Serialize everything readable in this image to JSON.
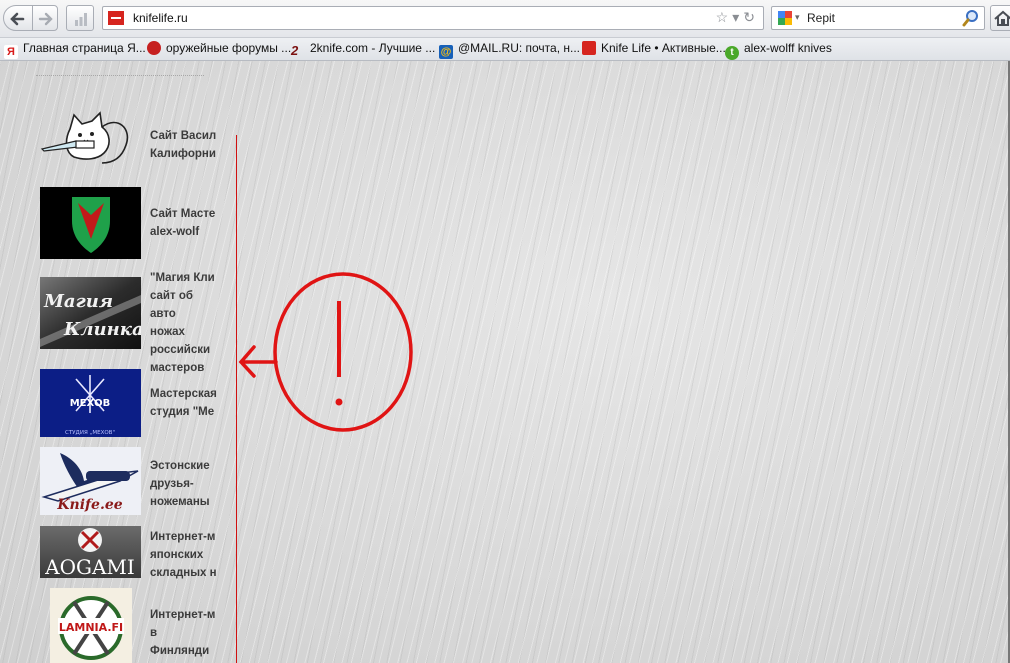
{
  "browser": {
    "url": "knifelife.ru",
    "search_engine_icon": "google-icon",
    "search_text": "Repit"
  },
  "bookmarks": [
    {
      "label": "Главная страница Я...",
      "icon": "yandex-icon",
      "color": "#d81c1c"
    },
    {
      "label": "оружейные форумы ...",
      "icon": "forum-icon",
      "color": "#c62020"
    },
    {
      "label": "2knife.com - Лучшие ...",
      "icon": "2knife-icon",
      "color": "#7b1010"
    },
    {
      "label": "@MAIL.RU: почта, н...",
      "icon": "mailru-icon",
      "color": "#1760b8"
    },
    {
      "label": "Knife Life • Активные...",
      "icon": "knifelife-icon",
      "color": "#d6251f"
    },
    {
      "label": "alex-wolff knives",
      "icon": "leaf-icon",
      "color": "#4aa82a"
    }
  ],
  "links": [
    {
      "caption": "Сайт Васил\nКалифорни",
      "logo": "cat-knife-logo"
    },
    {
      "caption": " Сайт Масте\nalex-wolf",
      "logo": "alex-wolff-shield-logo"
    },
    {
      "caption": "\"Магия Кли\nсайт об авто\nножах\nроссийски\nмастеров",
      "logo": "magiya-klinka-logo",
      "logo_text": [
        "Магия",
        "Клинка"
      ]
    },
    {
      "caption": "Мастерская\nстудия \"Ме",
      "logo": "mehov-studio-logo",
      "logo_text": [
        "МЕХОВ",
        "СТУДИЯ „МЕХОВ\""
      ]
    },
    {
      "caption": "Эстонские\nдрузья-\nножеманы",
      "logo": "knife-ee-logo",
      "logo_text": [
        "Knife.ee"
      ]
    },
    {
      "caption": "Интернет-м\nяпонских\nскладных н",
      "logo": "aogami-logo",
      "logo_text": [
        "AOGAMI"
      ]
    },
    {
      "caption": "Интернет-м\nв Финлянди",
      "logo": "lamnia-logo",
      "logo_text": [
        "LAMNIA.FI"
      ]
    }
  ],
  "annotation": {
    "color": "#e01414",
    "symbol": "!"
  }
}
